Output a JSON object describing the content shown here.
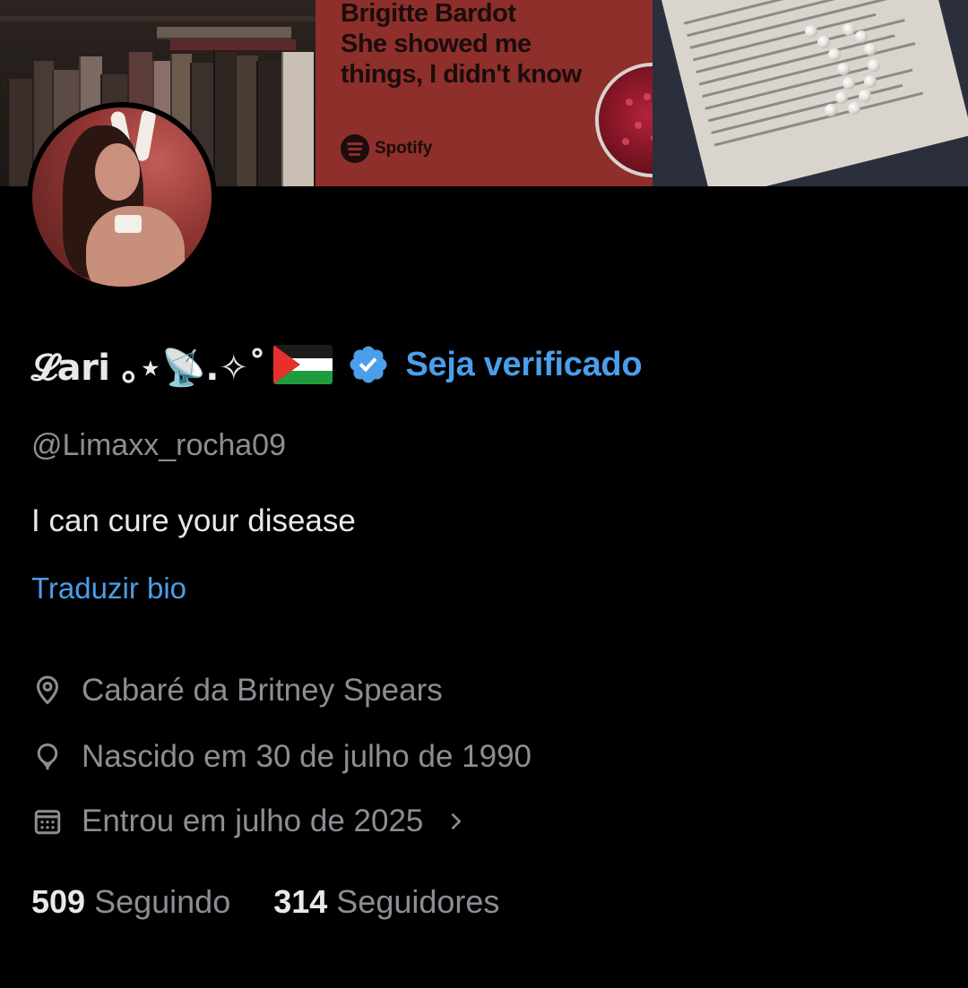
{
  "banner": {
    "lyric_lines": [
      "Brigitte Bardot",
      "She showed me",
      "things, I didn't know"
    ],
    "spotify_label": "Spotify",
    "card_color": "#8e2f2b"
  },
  "profile": {
    "display_name": "𝓛ari ｡⋆📡.✧˚",
    "verified_icon": "verified-badge-icon",
    "verify_cta": "Seja verificado",
    "handle": "@Limaxx_rocha09",
    "bio": "I can cure your disease",
    "translate_bio": "Traduzir bio",
    "location": "Cabaré da Britney Spears",
    "birthday": "Nascido em 30 de julho de 1990",
    "joined": "Entrou em julho de 2025",
    "following_count": "509",
    "following_label": "Seguindo",
    "followers_count": "314",
    "followers_label": "Seguidores"
  },
  "colors": {
    "background": "#000000",
    "accent": "#4b9ee9",
    "secondary_text": "#8b8f93",
    "primary_text": "#e7e9ea"
  }
}
